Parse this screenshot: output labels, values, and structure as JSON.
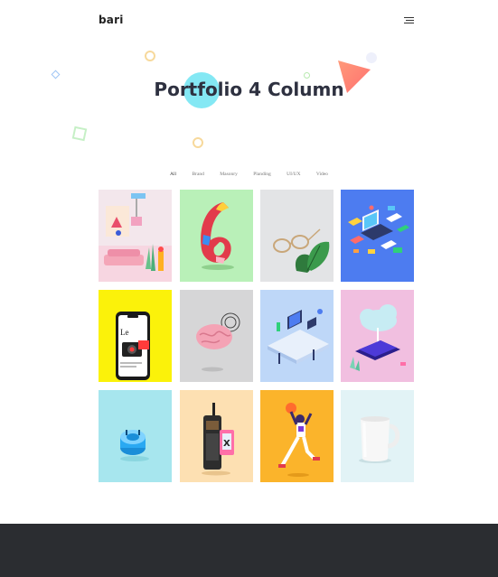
{
  "header": {
    "logo": "bari"
  },
  "hero": {
    "title": "Portfolio 4 Column"
  },
  "filters": [
    "All",
    "Brand",
    "Masonry",
    "Planding",
    "UI/UX",
    "Video"
  ],
  "active_filter": "All",
  "colors": {
    "title": "#2e3140",
    "footer": "#2b2d31",
    "tile_backgrounds": [
      "#f3e7ec",
      "#b9f0b8",
      "#e3e4e6",
      "#4d7cf0",
      "#fbf20a",
      "#d6d6d7",
      "#bed7f8",
      "#f1bfe0",
      "#a7e6ee",
      "#fde0b2",
      "#fbb42b",
      "#e2f3f6"
    ]
  },
  "portfolio": [
    {
      "icon": "interior-illustration"
    },
    {
      "icon": "number-six-3d"
    },
    {
      "icon": "eyeglasses-leaf"
    },
    {
      "icon": "isometric-devices"
    },
    {
      "icon": "smartphone-camera"
    },
    {
      "icon": "pink-brain"
    },
    {
      "icon": "isometric-workspace"
    },
    {
      "icon": "cloud-phone"
    },
    {
      "icon": "blue-gadget"
    },
    {
      "icon": "retro-phone"
    },
    {
      "icon": "basketball-player"
    },
    {
      "icon": "white-mug"
    }
  ]
}
